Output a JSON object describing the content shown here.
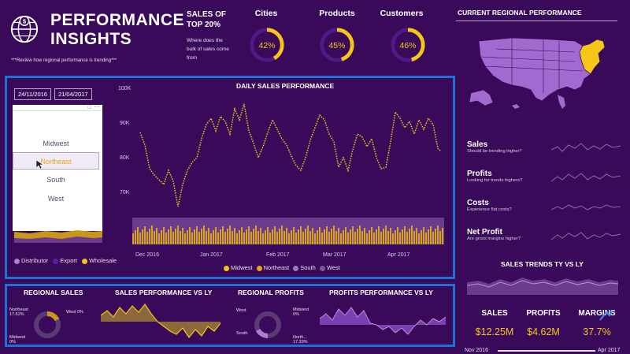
{
  "header": {
    "title_line1": "PERFORMANCE",
    "title_line2": "INSIGHTS",
    "subtitle": "***Review how regional performance is trending***"
  },
  "top20": {
    "heading_line1": "SALES OF",
    "heading_line2": "TOP 20%",
    "description": "Where does the bulk of sales come from"
  },
  "rings": [
    {
      "label": "Cities",
      "value": "42%",
      "fraction": 0.42
    },
    {
      "label": "Products",
      "value": "45%",
      "fraction": 0.45
    },
    {
      "label": "Customers",
      "value": "46%",
      "fraction": 0.46
    }
  ],
  "map_panel": {
    "title": "CURRENT REGIONAL PERFORMANCE"
  },
  "filters": {
    "date_start": "24/11/2016",
    "date_end": "21/04/2017"
  },
  "slicer": {
    "items": [
      "Midwest",
      "Northeast",
      "South",
      "West"
    ],
    "selected": "Northeast"
  },
  "channel_legend": [
    "Distributor",
    "Export",
    "Wholesale"
  ],
  "daily_chart": {
    "title": "DAILY SALES PERFORMANCE",
    "y_ticks": [
      "100K",
      "90K",
      "80K",
      "70K"
    ],
    "x_ticks": [
      "Dec 2016",
      "Jan 2017",
      "Feb 2017",
      "Mar 2017",
      "Apr 2017"
    ],
    "legend": [
      "Midwest",
      "Northeast",
      "South",
      "West"
    ]
  },
  "metrics": [
    {
      "name": "Sales",
      "desc": "Should be trending higher?"
    },
    {
      "name": "Profits",
      "desc": "Looking for trends highers?"
    },
    {
      "name": "Costs",
      "desc": "Experience flat costs?"
    },
    {
      "name": "Net Profit",
      "desc": "Are gross margins higher?"
    }
  ],
  "sales_trends": {
    "title": "SALES TRENDS TY VS LY"
  },
  "kpis": [
    {
      "label": "SALES",
      "value": "$12.25M"
    },
    {
      "label": "PROFITS",
      "value": "$4.62M"
    },
    {
      "label": "MARGINS",
      "value": "37.7%"
    }
  ],
  "timeline": {
    "start": "Nov 2016",
    "end": "Apr 2017"
  },
  "bottom": {
    "regional_sales": {
      "title": "REGIONAL SALES",
      "labels": {
        "northeast": "Northeast",
        "northeast_pct": "17.62%",
        "west": "West 0%",
        "midwest": "Midwest",
        "midwest_pct": "0%"
      }
    },
    "sales_vs_ly": {
      "title": "SALES PERFORMANCE VS LY"
    },
    "regional_profits": {
      "title": "REGIONAL PROFITS",
      "labels": {
        "west": "West",
        "midwest": "Midwest",
        "midwest_pct": "0%",
        "south": "South",
        "north": "North...",
        "north_pct": "17.33%"
      }
    },
    "profits_vs_ly": {
      "title": "PROFITS PERFORMANCE VS LY"
    }
  },
  "colors": {
    "background": "#3a0a5a",
    "accent": "#f5c518",
    "highlight_box": "#1e6fd6",
    "map_fill": "#a26ad1"
  }
}
